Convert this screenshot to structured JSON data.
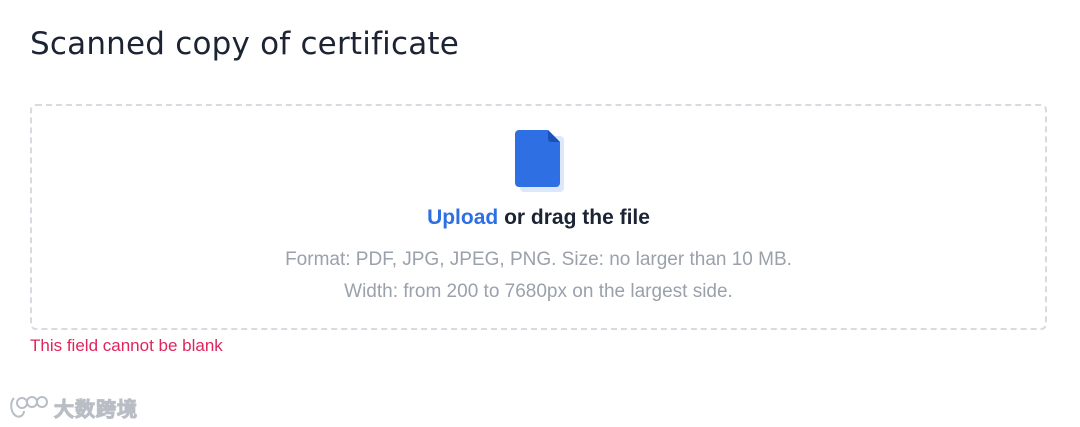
{
  "section": {
    "title": "Scanned copy of certificate"
  },
  "upload": {
    "icon": "file-icon",
    "link_label": "Upload",
    "rest_label": " or drag the file",
    "format_hint": "Format: PDF, JPG, JPEG, PNG. Size: no larger than 10 MB.",
    "size_hint": "Width: from 200 to 7680px on the largest side."
  },
  "validation": {
    "error_message": "This field cannot be blank"
  },
  "watermark": {
    "text": "大数跨境"
  },
  "colors": {
    "title": "#1c2434",
    "link": "#2f6fe4",
    "hint": "#9aa1ab",
    "error": "#e0245e",
    "dashed_border": "#d6dbe1",
    "icon_blue": "#2f6fe4"
  }
}
